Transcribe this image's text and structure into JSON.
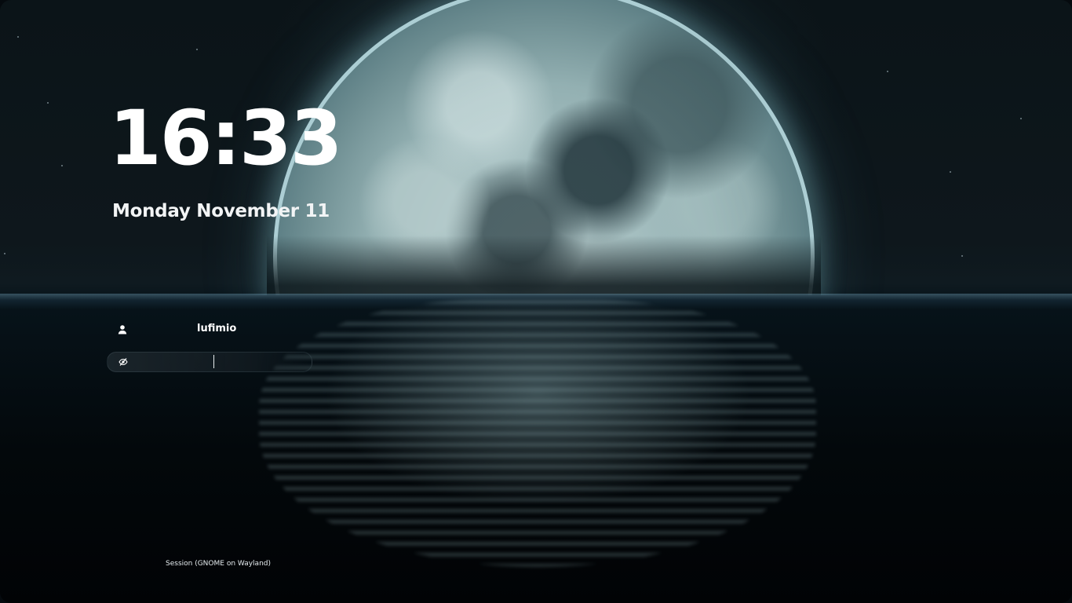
{
  "lock_screen": {
    "time": "16:33",
    "date": "Monday November 11"
  },
  "login": {
    "username": "lufimio",
    "user_icon": "user-icon",
    "password_placeholder": "",
    "password_toggle_icon": "eye-slash-icon"
  },
  "session": {
    "label": "Session (GNOME on Wayland)"
  },
  "wallpaper": {
    "description_icon": "moon-over-sea",
    "accent": "#9fc6cc",
    "sky": "#0e171c",
    "water": "#03080b"
  }
}
